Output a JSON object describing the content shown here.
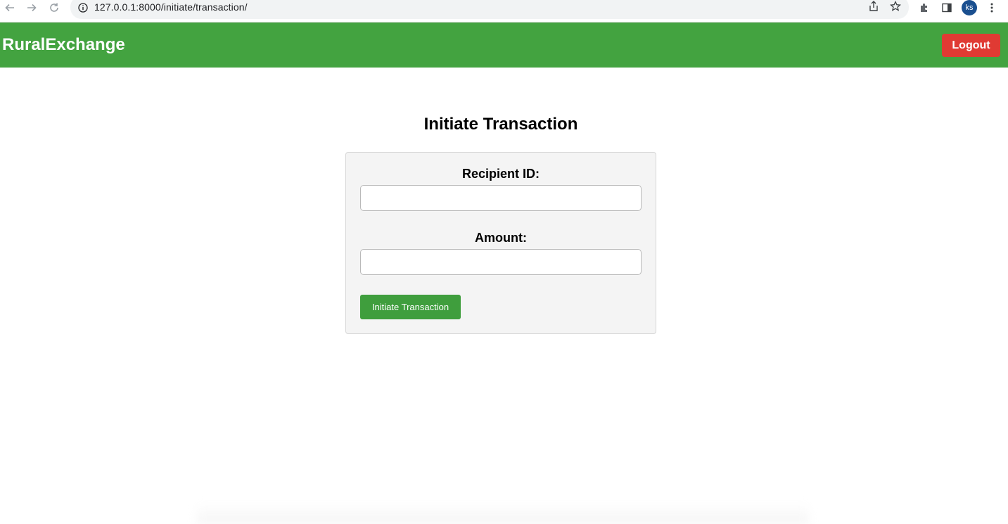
{
  "browser": {
    "url": "127.0.0.1:8000/initiate/transaction/",
    "profile_initials": "ks",
    "icons": [
      "back-arrow-icon",
      "forward-arrow-icon",
      "reload-icon",
      "info-icon",
      "share-icon",
      "star-icon",
      "extensions-icon",
      "side-panel-icon",
      "kebab-menu-icon"
    ]
  },
  "header": {
    "brand": "RuralExchange",
    "logout_label": "Logout",
    "background_color": "#43a340",
    "logout_color": "#e03a33"
  },
  "main": {
    "title": "Initiate Transaction",
    "form": {
      "recipient_label": "Recipient ID:",
      "recipient_value": "",
      "amount_label": "Amount:",
      "amount_value": "",
      "submit_label": "Initiate Transaction",
      "submit_color": "#3f9e3d"
    }
  }
}
